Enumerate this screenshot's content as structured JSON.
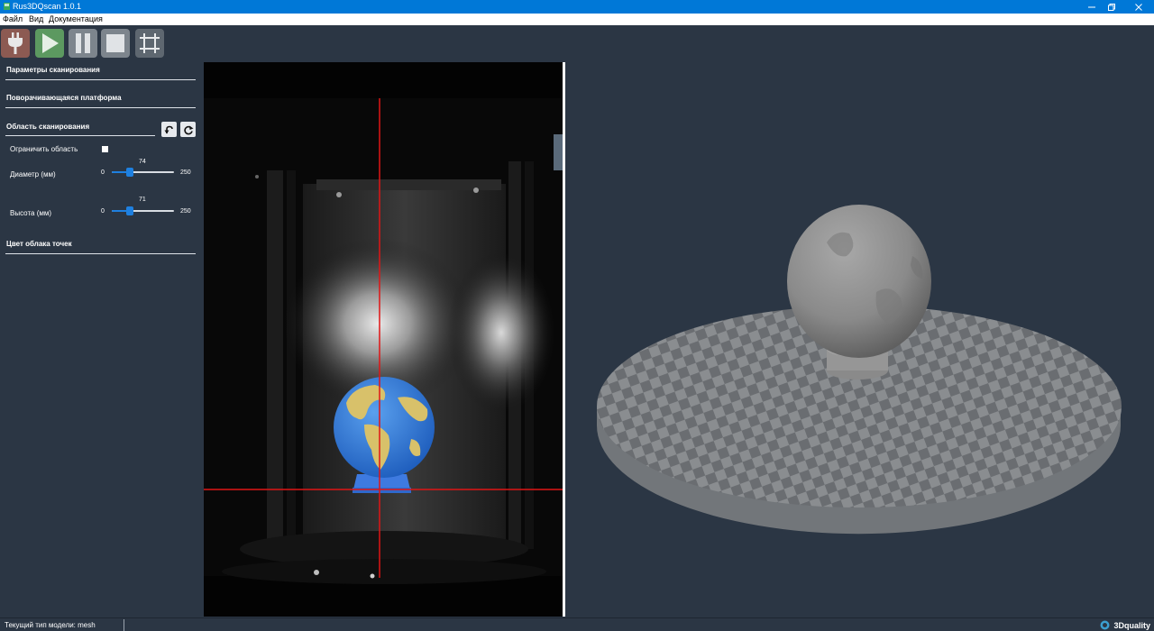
{
  "window": {
    "title": "Rus3DQscan 1.0.1"
  },
  "menu": {
    "items": [
      "Файл",
      "Вид",
      "Документация"
    ]
  },
  "toolbar": {
    "buttons": [
      {
        "icon": "plug-icon",
        "color": "#8c5a52"
      },
      {
        "icon": "play-icon",
        "color": "#5c9960"
      },
      {
        "icon": "pause-icon",
        "color": "#7d858d"
      },
      {
        "icon": "stop-icon",
        "color": "#7d858d"
      },
      {
        "icon": "crop-icon",
        "color": "#5e6770"
      }
    ]
  },
  "panel": {
    "scan_params": "Параметры сканирования",
    "rotating_platform": "Поворачивающаяся платформа",
    "scan_area": "Область сканирования",
    "limit_area": "Ограничить область",
    "limit_area_checked": false,
    "diameter": {
      "label": "Диаметр (мм)",
      "min": "0",
      "max": "250",
      "value": "74",
      "fraction": 0.296
    },
    "height": {
      "label": "Высота (мм)",
      "min": "0",
      "max": "250",
      "value": "71",
      "fraction": 0.284
    },
    "point_cloud_color": "Цвет облака точек"
  },
  "status": {
    "text": "Текущий тип модели: mesh",
    "brand": "3Dquality"
  },
  "colors": {
    "background": "#2b3644",
    "titlebar": "#0078d7",
    "accent": "#1e80e0",
    "crosshair": "#e01515"
  }
}
